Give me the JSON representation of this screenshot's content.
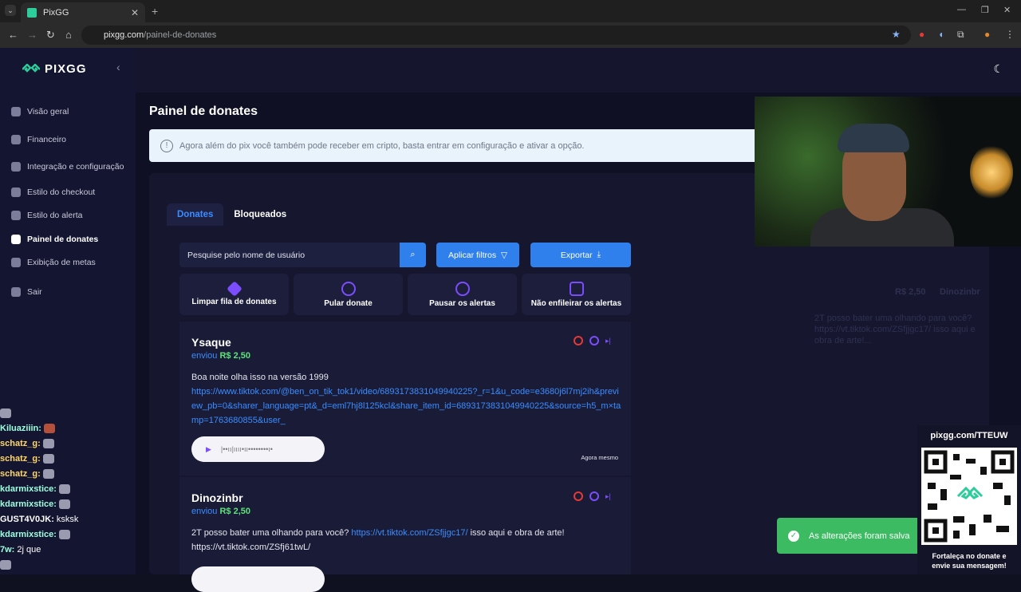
{
  "browser": {
    "tab_title": "PixGG",
    "url_host": "pixgg.com",
    "url_path": "/painel-de-donates"
  },
  "sidebar": {
    "brand": "PIXGG",
    "items": [
      {
        "label": "Visão geral",
        "icon": "home-icon"
      },
      {
        "label": "Financeiro",
        "icon": "wallet-icon"
      },
      {
        "label": "Integração e configuração",
        "icon": "settings-icon"
      },
      {
        "label": "Estilo do checkout",
        "icon": "palette-icon"
      },
      {
        "label": "Estilo do alerta",
        "icon": "palette-icon"
      },
      {
        "label": "Painel de donates",
        "icon": "hand-donate-icon"
      },
      {
        "label": "Exibição de metas",
        "icon": "star-icon"
      },
      {
        "label": "Sair",
        "icon": "logout-icon"
      }
    ]
  },
  "page": {
    "title": "Painel de donates",
    "banner": "Agora além do pix você também pode receber em cripto, basta entrar em configuração e ativar a opção."
  },
  "tabs": [
    {
      "label": "Donates",
      "active": true
    },
    {
      "label": "Bloqueados",
      "active": false
    }
  ],
  "toolbar": {
    "search_placeholder": "Pesquise pelo nome de usuário",
    "filters_label": "Aplicar filtros",
    "export_label": "Exportar"
  },
  "actions": [
    {
      "label": "Limpar fila de donates",
      "icon": "eraser-icon"
    },
    {
      "label": "Pular donate",
      "icon": "skip-icon"
    },
    {
      "label": "Pausar os alertas",
      "icon": "pause-icon"
    },
    {
      "label": "Não enfileirar os alertas",
      "icon": "bell-off-icon"
    }
  ],
  "donations": [
    {
      "name": "Ysaque",
      "sent_label": "enviou",
      "amount": "R$ 2,50",
      "message_text": "Boa noite olha isso na versão 1999",
      "message_link": "https://www.tiktok.com/@ben_on_tik_tok1/video/6893173831049940225?_r=1&u_code=e3680j6l7mj2ih&preview_pb=0&sharer_language=pt&_d=eml7hj8l125kcl&share_item_id=6893173831049940225&source=h5_m×tamp=1763680855&user_",
      "time": "Agora mesmo"
    },
    {
      "name": "Dinozinbr",
      "sent_label": "enviou",
      "amount": "R$ 2,50",
      "message_pre": "2T posso bater uma olhando para você?",
      "message_link": "https://vt.tiktok.com/ZSfjjgc17/",
      "message_post": "isso aqui e obra de arte!",
      "message_line2": "https://vt.tiktok.com/ZSfj61twL/"
    }
  ],
  "overlay": {
    "ghost_amount": "R$ 2,50",
    "ghost_name": "Dinozinbr",
    "ghost_message": "2T posso bater uma olhando para você? https://vt.tiktok.com/ZSfjjgc17/ isso aqui e obra de arte!..."
  },
  "chat": [
    {
      "user": "",
      "text": ""
    },
    {
      "user": "Kiluaziiin:",
      "text": ""
    },
    {
      "user": "schatz_g:",
      "text": ""
    },
    {
      "user": "schatz_g:",
      "text": ""
    },
    {
      "user": "schatz_g:",
      "text": ""
    },
    {
      "user": "kdarmixstice:",
      "text": ""
    },
    {
      "user": "kdarmixstice:",
      "text": ""
    },
    {
      "user": "GUST4V0JK:",
      "text": "ksksk"
    },
    {
      "user": "kdarmixstice:",
      "text": ""
    },
    {
      "user": "7w:",
      "text": "2j que"
    }
  ],
  "toast": "As alterações foram salva",
  "qr": {
    "url": "pixgg.com/TTEUW",
    "caption_1": "Fortaleça no donate e",
    "caption_2": "envie sua mensagem!"
  },
  "colors": {
    "accent": "#2f80ed",
    "amount": "#5ce37a",
    "success": "#3dbb62",
    "sidebar": "#141530"
  }
}
